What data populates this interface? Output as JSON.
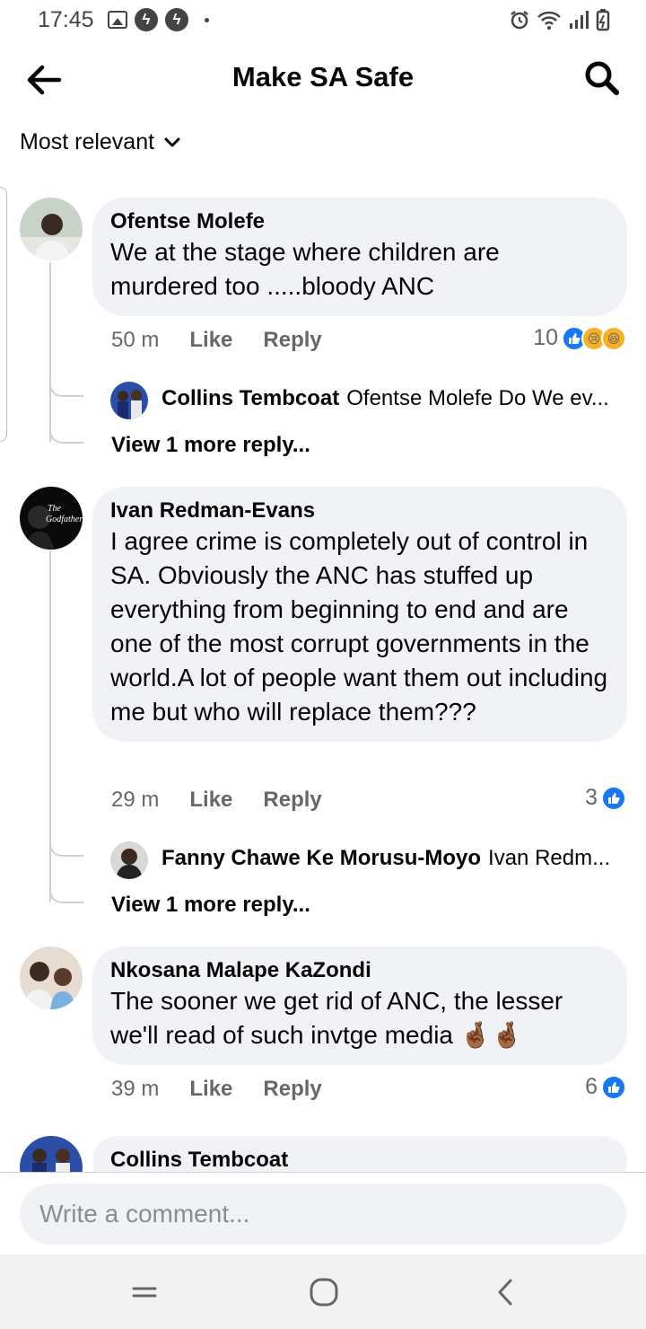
{
  "status_bar": {
    "time": "17:45",
    "left_icons": [
      "image-icon",
      "bolt-icon",
      "bolt-icon",
      "dot-icon"
    ],
    "right_icons": [
      "alarm-icon",
      "wifi-icon",
      "signal-icon",
      "battery-icon"
    ]
  },
  "header": {
    "title": "Make SA Safe",
    "back_icon": "arrow-left-icon",
    "search_icon": "search-icon"
  },
  "sort": {
    "label": "Most relevant",
    "icon": "chevron-down-icon"
  },
  "comments": [
    {
      "author": "Ofentse Molefe",
      "text": "We at the stage where children are murdered too .....bloody ANC",
      "time": "50 m",
      "like_label": "Like",
      "reply_label": "Reply",
      "reaction_count": "10",
      "reactions": [
        "like",
        "sad",
        "haha"
      ],
      "reply_preview": {
        "author": "Collins Tembcoat",
        "text": "Ofentse Molefe Do We ev..."
      },
      "view_more": "View 1 more reply..."
    },
    {
      "author": "Ivan Redman-Evans",
      "avatar_text": "The Godfather",
      "text": "I agree crime is completely out of control in SA. Obviously the ANC has stuffed up everything from beginning to end and are one of the most corrupt governments in the world.A lot of people want them out including me but who will replace them???",
      "time": "29 m",
      "like_label": "Like",
      "reply_label": "Reply",
      "reaction_count": "3",
      "reactions": [
        "like"
      ],
      "reply_preview": {
        "author": "Fanny Chawe Ke Morusu-Moyo",
        "text": "Ivan Redm..."
      },
      "view_more": "View 1 more reply..."
    },
    {
      "author": "Nkosana Malape KaZondi",
      "text": "The sooner we get rid of ANC, the lesser we'll read of such invtge media 🤞🏾🤞🏾",
      "time": "39 m",
      "like_label": "Like",
      "reply_label": "Reply",
      "reaction_count": "6",
      "reactions": [
        "like"
      ]
    },
    {
      "author": "Collins Tembcoat"
    }
  ],
  "composer": {
    "placeholder": "Write a comment..."
  },
  "nav_bar": {
    "icons": [
      "recent-apps-icon",
      "home-icon",
      "back-icon"
    ]
  },
  "colors": {
    "accent": "#1877f2",
    "bubble": "#f0f2f5",
    "secondary_text": "#65676b"
  }
}
